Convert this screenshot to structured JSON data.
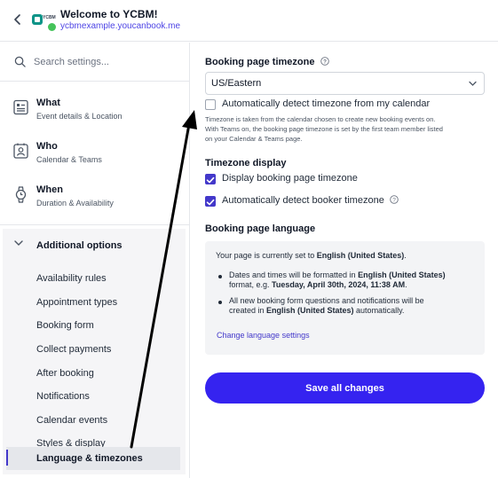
{
  "header": {
    "title": "Welcome to YCBM!",
    "url": "ycbmexample.youcanbook.me",
    "logo_text": "YCBM"
  },
  "sidebar": {
    "search_placeholder": "Search settings...",
    "nav": [
      {
        "title": "What",
        "subtitle": "Event details & Location",
        "icon": "list-icon"
      },
      {
        "title": "Who",
        "subtitle": "Calendar & Teams",
        "icon": "contact-card-icon"
      },
      {
        "title": "When",
        "subtitle": "Duration & Availability",
        "icon": "watch-icon"
      }
    ],
    "options_title": "Additional options",
    "options": [
      "Availability rules",
      "Appointment types",
      "Booking form",
      "Collect payments",
      "After booking",
      "Notifications",
      "Calendar events",
      "Styles & display",
      "Language & timezones"
    ],
    "active_option": "Language & timezones"
  },
  "main": {
    "timezone_label": "Booking page timezone",
    "timezone_value": "US/Eastern",
    "auto_detect_calendar_label": "Automatically detect timezone from my calendar",
    "auto_detect_calendar_checked": false,
    "timezone_help_1": "Timezone is taken from the calendar chosen to create new booking events on.",
    "timezone_help_2": "With Teams on, the booking page timezone is set by the first team member listed",
    "timezone_help_3": "on your Calendar & Teams page.",
    "timezone_display_label": "Timezone display",
    "display_timezone_label": "Display booking page timezone",
    "display_timezone_checked": true,
    "detect_booker_label": "Automatically detect booker timezone",
    "detect_booker_checked": true,
    "language_label": "Booking page language",
    "language_intro_prefix": "Your page is currently set to ",
    "language_name": "English (United States)",
    "language_intro_suffix": ".",
    "bullet1_prefix": "Dates and times will be formatted in ",
    "bullet1_lang": "English (United States)",
    "bullet1_mid": "format, e.g. ",
    "bullet1_example": "Tuesday, April 30th, 2024, 11:38 AM",
    "bullet1_end": ".",
    "bullet2_prefix": "All new booking form questions and notifications will be",
    "bullet2_mid": "created in ",
    "bullet2_lang": "English (United States)",
    "bullet2_end": " automatically.",
    "change_language_link": "Change language settings",
    "save_button": "Save all changes"
  },
  "colors": {
    "accent": "#3523f0",
    "checkbox_on": "#4338ca",
    "online": "#45c35a",
    "link": "#4f46e5"
  }
}
